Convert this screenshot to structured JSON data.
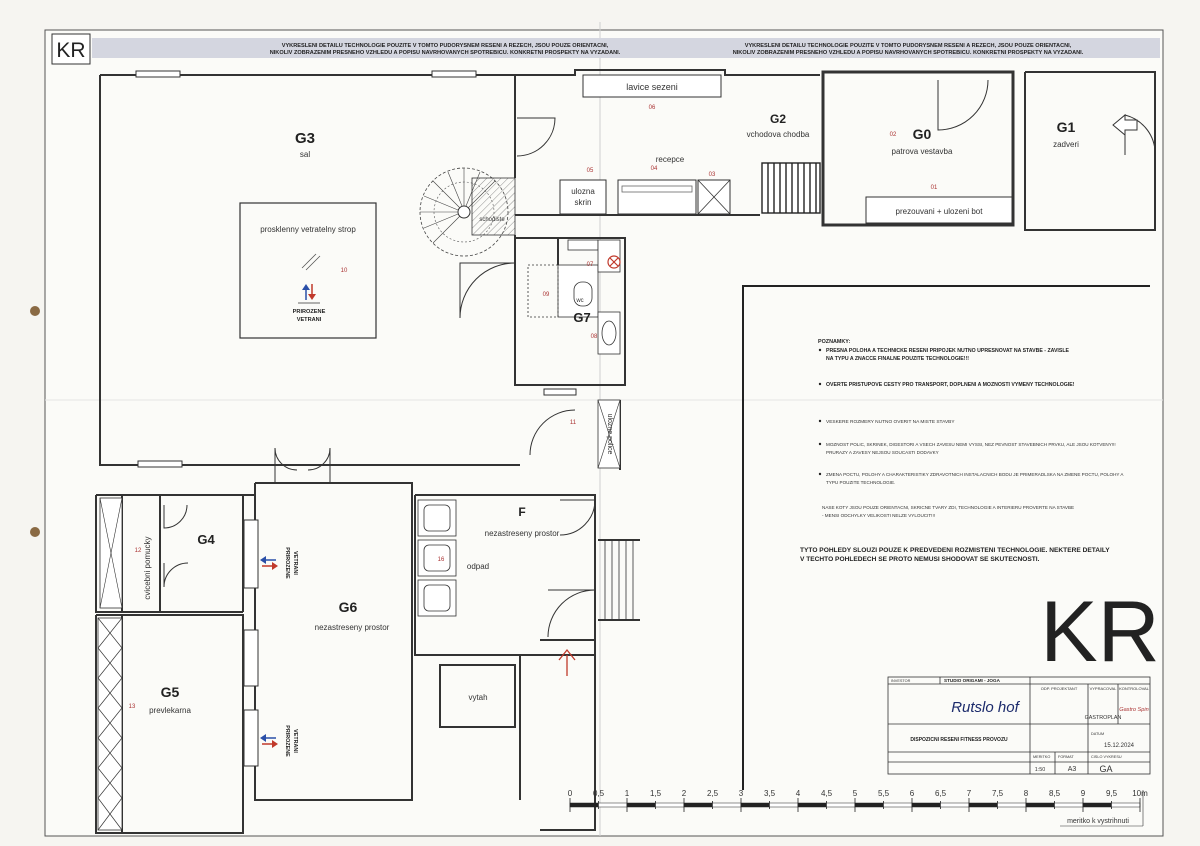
{
  "header": {
    "logo": "KR",
    "disclaimer_line1": "VYKRESLENI DETAILU TECHNOLOGIE POUZITE V TOMTO PUDORYSNEM RESENI A REZECH, JSOU POUZE ORIENTACNI,",
    "disclaimer_line2": "NIKOLIV ZOBRAZENIM PRESNEHO VZHLEDU A POPISU NAVRHOVANYCH SPOTREBICU. KONKRETNI PROSPEKTY NA VYZADANI."
  },
  "rooms": {
    "G0": {
      "code": "G0",
      "name": "patrova vestavba"
    },
    "G1": {
      "code": "G1",
      "name": "zadveri"
    },
    "G2": {
      "code": "G2",
      "name": "vchodova chodba"
    },
    "G3": {
      "code": "G3",
      "name": "sal"
    },
    "G4": {
      "code": "G4"
    },
    "G5": {
      "code": "G5",
      "name": "prevlekarna"
    },
    "G6": {
      "code": "G6",
      "name": "nezastreseny prostor"
    },
    "G7": {
      "code": "G7",
      "wc": "wc"
    },
    "F": {
      "code": "F",
      "name": "nezastreseny prostor"
    }
  },
  "labels": {
    "lavice": "lavice sezeni",
    "recepce": "recepce",
    "ulozna_skrin_1": "ulozna",
    "ulozna_skrin_2": "skrin",
    "schodiste": "schodiste",
    "prosklenny": "prosklenny vetratelny strop",
    "prirozene_1": "PRIROZENE",
    "prirozene_2": "VETRANI",
    "prezouvani": "prezouvani + ulozeni bot",
    "ulozne_police": "ulozne police",
    "cvicebni_pomucky": "cvicebni pomucky",
    "odpad": "odpad",
    "vytah": "vytah"
  },
  "numbers": {
    "n01": "01",
    "n02": "02",
    "n03": "03",
    "n04": "04",
    "n05": "05",
    "n06": "06",
    "n07": "07",
    "n08": "08",
    "n09": "09",
    "n10": "10",
    "n11": "11",
    "n12": "12",
    "n13": "13",
    "n16": "16"
  },
  "notes": {
    "title": "POZNAMKY:",
    "items": [
      "PRESNA POLOHA A TECHNICKE RESENI PRIPOJEK NUTNO UPRESNOVAT NA STAVBE - ZAVISLE",
      "NA TYPU A ZNACCE FINALNE POUZITE TECHNOLOGIE!!!",
      "OVERTE PRISTUPOVE CESTY PRO TRANSPORT, DOPLNENI A MOZNOSTI VYMENY TECHNOLOGIE!",
      "VESKERE ROZMERY NUTNO OVERIT NA MISTE STAVBY",
      "MOZNOST POLIC, SKRINEK, DIGESTORI A VSECH ZAVESU NEMI VYSSI, NEZ PEVNOST STAVEBNICH PRVKU, ALE JSOU KOTVENY!!!",
      "PRURAZY A ZAVESY NEJSOU SOUCASTI DODAVKY",
      "ZMENA POCTU, POLOHY A CHARAKTERISTIKY ZDRAVOTNICH INSTALACNICH BODU JE PRIMERADLSKA NA ZMENE POCTU, POLOHY A",
      "TYPU POUZITE TECHNOLOGIE.",
      "NASE KOTY JSOU POUZE ORIENTACNI, SKRICNE TVARY ZDI, TECHNOLOGIE A INTERIERU PROVERTE NA STAVBE",
      "- MENSI ODCHYLKY VELIKOSTI NELZE VYLOUCIT!!!"
    ],
    "statement_1": "TYTO POHLEDY SLOUZI POUZE K PREDVEDENI ROZMISTENI TECHNOLOGIE. NEKTERE DETAILY",
    "statement_2": "V TECHTO POHLEDECH SE PROTO NEMUSI SHODOVAT SE SKUTECNOSTI."
  },
  "title_block": {
    "investor_label": "INVESTOR",
    "investor_value": "STUDIO ORIGAMI - JOGA",
    "zodp_label": "ODP. PROJEKTANT",
    "vypracoval_label": "VYPRACOVAL",
    "kontroloval_label": "KONTROLOVAL",
    "vypracoval_value": "GASTROPLAN",
    "brand": "Gastro Spin",
    "signature": "Rutslo hof",
    "datum_label": "DATUM",
    "datum_value": "15.12.2024",
    "nazev": "DISPOZICNI RESENI FITNESS PROVOZU",
    "cislo_label": "CISLO PLANU",
    "format_label": "FORMAT",
    "format_value": "A3",
    "mer_label": "MERITKO",
    "mer_value": "1:50",
    "cis_value": "GA",
    "pages_label": "CISLO VYKRESU"
  },
  "scale_bar": {
    "ticks": [
      "0",
      "0,5",
      "1",
      "1,5",
      "2",
      "2,5",
      "3",
      "3,5",
      "4",
      "4,5",
      "5",
      "5,5",
      "6",
      "6,5",
      "7",
      "7,5",
      "8",
      "8,5",
      "9",
      "9,5",
      "10m"
    ],
    "caption": "meritko k vystrihnuti"
  },
  "big_logo": "KR"
}
